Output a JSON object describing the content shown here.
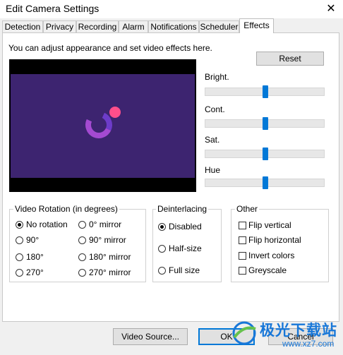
{
  "window": {
    "title": "Edit Camera Settings",
    "close_glyph": "✕"
  },
  "tabs": [
    {
      "label": "Detection"
    },
    {
      "label": "Privacy"
    },
    {
      "label": "Recording"
    },
    {
      "label": "Alarm"
    },
    {
      "label": "Notifications"
    },
    {
      "label": "Scheduler"
    },
    {
      "label": "Effects",
      "active": true
    }
  ],
  "effects": {
    "intro": "You can adjust appearance and set video effects here.",
    "reset_label": "Reset",
    "sliders": [
      {
        "label": "Bright.",
        "value": 0.5
      },
      {
        "label": "Cont.",
        "value": 0.5
      },
      {
        "label": "Sat.",
        "value": 0.5
      },
      {
        "label": "Hue",
        "value": 0.5
      }
    ]
  },
  "rotation": {
    "title": "Video Rotation (in degrees)",
    "options": [
      "No rotation",
      "0° mirror",
      "90°",
      "90° mirror",
      "180°",
      "180° mirror",
      "270°",
      "270° mirror"
    ],
    "selected": "No rotation"
  },
  "deinterlacing": {
    "title": "Deinterlacing",
    "options": [
      "Disabled",
      "Half-size",
      "Full size"
    ],
    "selected": "Disabled"
  },
  "other": {
    "title": "Other",
    "options": [
      {
        "label": "Flip vertical",
        "checked": false
      },
      {
        "label": "Flip horizontal",
        "checked": false
      },
      {
        "label": "Invert colors",
        "checked": false
      },
      {
        "label": "Greyscale",
        "checked": false
      }
    ]
  },
  "footer": {
    "video_source_label": "Video Source...",
    "ok_label": "OK",
    "cancel_label": "Cancel"
  },
  "watermark": {
    "text": "极光下载站",
    "url": "www.xz7.com"
  },
  "colors": {
    "accent": "#0078d7",
    "preview_bg": "#3d2470",
    "logo_dot": "#ff4f8b",
    "logo_arc": "#a44ad1"
  }
}
